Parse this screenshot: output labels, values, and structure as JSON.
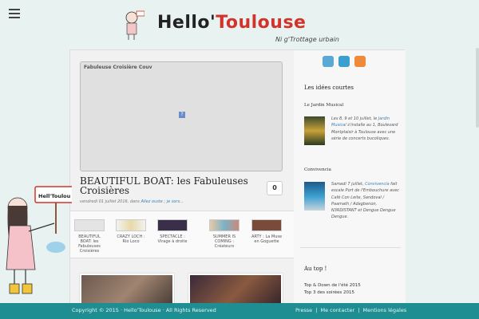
{
  "header": {
    "menu_icon": "hamburger-menu-icon",
    "logo_title_prefix": "Hello'",
    "logo_title_accent": "Toulouse",
    "logo_tagline": "Ni g'Trottage urbain"
  },
  "main": {
    "video_title": "Fabuleuse Croisière Couv",
    "video_placeholder": "?",
    "post_title": "BEAUTIFUL BOAT: les Fabuleuses Croisières",
    "comment_count": "0",
    "post_date": "vendredi 01 juillet 2016",
    "post_in": ", dans ",
    "post_category": "Allez ouste ; je sors...",
    "related": [
      {
        "label": "BEAUTIFUL BOAT: les Fabuleuses Croisières"
      },
      {
        "label": "CRAZY LOCH : Rio Loco"
      },
      {
        "label": "SPECTACLE : Virage à droite"
      },
      {
        "label": "SUMMER IS COMING : Créateurs"
      },
      {
        "label": "ARTY : La Muse en Goguette"
      }
    ]
  },
  "sidebar": {
    "social_icons": [
      "twitter-icon",
      "vimeo-icon",
      "rss-icon"
    ],
    "short_ideas_heading": "Les idées courtes",
    "item1": {
      "title": "Le Jardin Musical",
      "text_1": "Les 8, 9 et 10 juillet, le ",
      "text_link": "Jardin Musical",
      "text_2": " s'installe au 1, Boulevard Montplaisir à Toulouse avec une série de concerts bucoliques."
    },
    "item2": {
      "title": "Convivencia",
      "text_1": "Samedi 7 juillet, ",
      "text_link": "Convivencia",
      "text_2": " fait escale Port de l'Embouchure avec Café Con Leite, Sandoval / Paamath / Adagbenon, N3RDISTANT et Dengue Dengue Dengue."
    },
    "top_heading": "Au top !",
    "top_items": [
      "Top & Down de l'été 2015",
      "Top 3 des soirées 2015"
    ]
  },
  "footer": {
    "copyright": "Copyright © 2015 · Hello'Toulouse · All Rights Reserved",
    "links": [
      "Presse",
      "Me contacter",
      "Mentions légales"
    ],
    "separator": "|"
  },
  "colors": {
    "page_bg": "#e8f3f1",
    "footer_bg": "#1e8e93",
    "accent_red": "#d2342c",
    "link_blue": "#3a7fb4"
  }
}
